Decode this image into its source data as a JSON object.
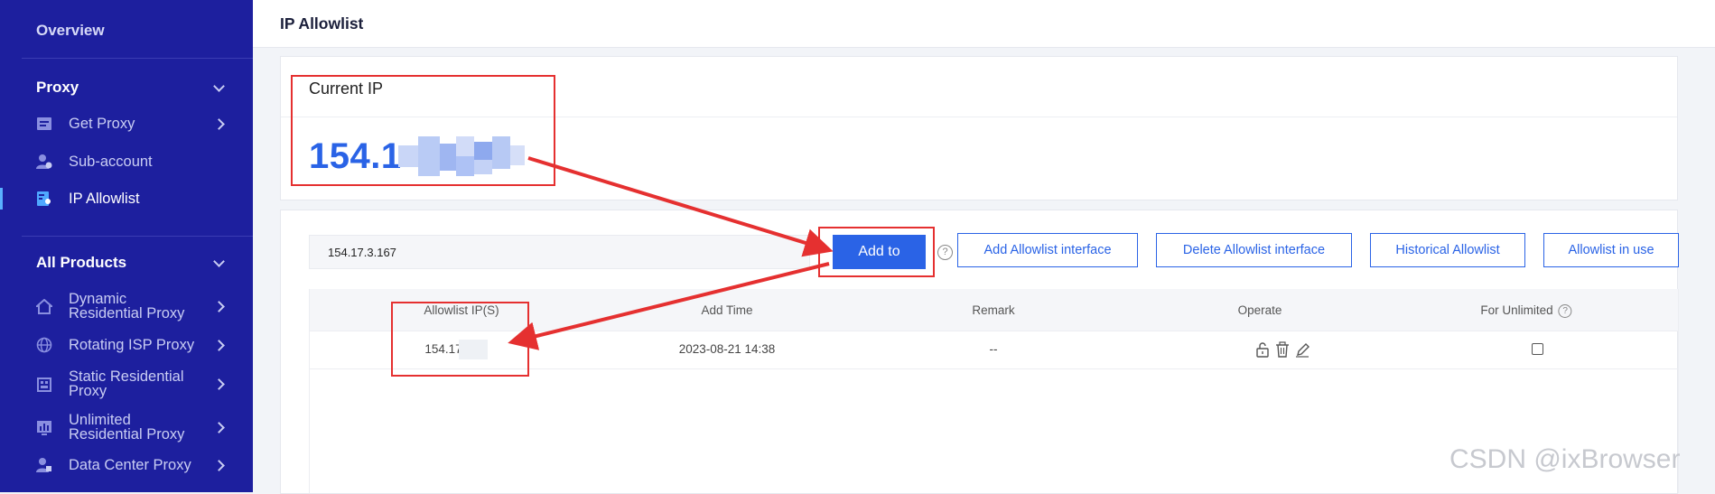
{
  "sidebar": {
    "overview": "Overview",
    "proxy_section": "Proxy",
    "proxy_items": [
      {
        "label": "Get Proxy",
        "icon": "list-icon"
      },
      {
        "label": "Sub-account",
        "icon": "user-add-icon"
      },
      {
        "label": "IP Allowlist",
        "icon": "allowlist-icon",
        "active": true
      }
    ],
    "products_section": "All Products",
    "product_items": [
      {
        "label": "Dynamic Residential Proxy",
        "icon": "home-icon"
      },
      {
        "label": "Rotating ISP Proxy",
        "icon": "globe-icon"
      },
      {
        "label": "Static Residential Proxy",
        "icon": "building-icon"
      },
      {
        "label": "Unlimited Residential Proxy",
        "icon": "chart-icon"
      },
      {
        "label": "Data Center Proxy",
        "icon": "user-server-icon"
      }
    ],
    "bg_color": "#1d1f9e"
  },
  "header": {
    "title": "IP Allowlist"
  },
  "current_ip": {
    "title": "Current IP",
    "value_visible": "154.1"
  },
  "allowlist_form": {
    "ip_value": "154.17.3.167",
    "add_button": "Add to",
    "help_glyph": "?",
    "buttons": [
      "Add Allowlist interface",
      "Delete Allowlist interface",
      "Historical Allowlist",
      "Allowlist in use"
    ]
  },
  "table": {
    "columns": [
      "Allowlist IP(S)",
      "Add Time",
      "Remark",
      "Operate",
      "For Unlimited"
    ],
    "rows": [
      {
        "ip": "154.17",
        "add_time": "2023-08-21 14:38",
        "remark": "--",
        "for_unlimited": false
      }
    ]
  },
  "watermark": "CSDN @ixBrowser",
  "colors": {
    "accent": "#2a63e6",
    "annotation": "#e53030"
  }
}
